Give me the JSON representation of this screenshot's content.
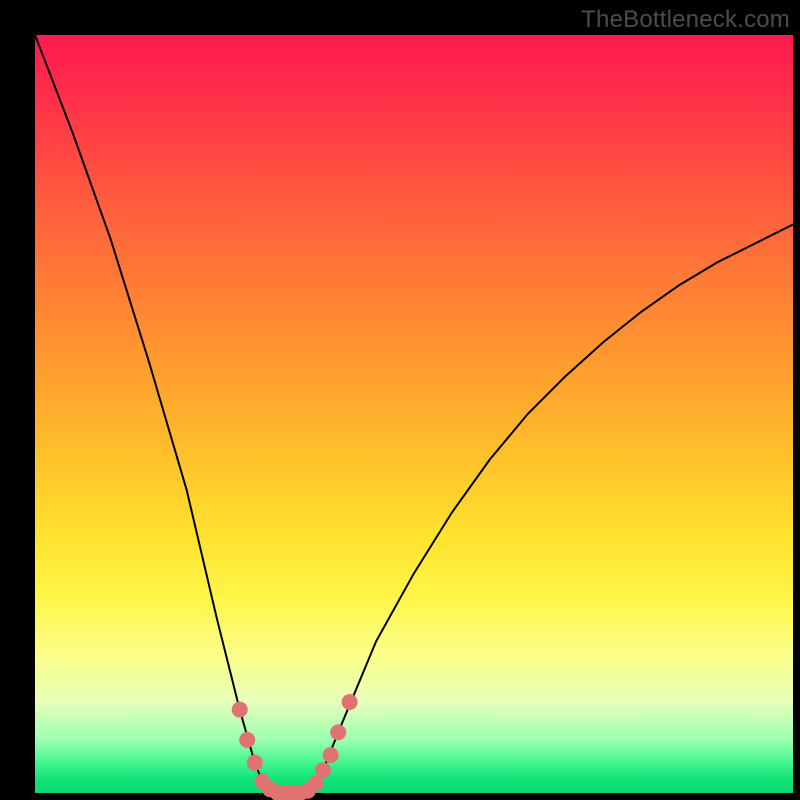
{
  "watermark": "TheBottleneck.com",
  "colors": {
    "frame": "#000000",
    "curve": "#000000",
    "marker": "#e07272",
    "gradient_top": "#ff1a4f",
    "gradient_bottom": "#0bd872"
  },
  "chart_data": {
    "type": "line",
    "title": "",
    "xlabel": "",
    "ylabel": "",
    "xlim": [
      0,
      100
    ],
    "ylim": [
      0,
      100
    ],
    "x": [
      0,
      5,
      10,
      15,
      20,
      24,
      27,
      29,
      30,
      31,
      32,
      33,
      34,
      35,
      36,
      37,
      38,
      40,
      45,
      50,
      55,
      60,
      65,
      70,
      75,
      80,
      85,
      90,
      95,
      100
    ],
    "y": [
      100,
      87,
      73,
      57,
      40,
      23,
      11,
      4,
      1.5,
      0.5,
      0,
      0,
      0,
      0,
      0.3,
      1.2,
      3,
      8,
      20,
      29,
      37,
      44,
      50,
      55,
      59.5,
      63.5,
      67,
      70,
      72.5,
      75
    ],
    "markers": [
      {
        "x": 27,
        "y": 11
      },
      {
        "x": 28,
        "y": 7
      },
      {
        "x": 29,
        "y": 4
      },
      {
        "x": 30,
        "y": 1.5
      },
      {
        "x": 31,
        "y": 0.5
      },
      {
        "x": 32,
        "y": 0
      },
      {
        "x": 33,
        "y": 0
      },
      {
        "x": 34,
        "y": 0
      },
      {
        "x": 35,
        "y": 0
      },
      {
        "x": 36,
        "y": 0.3
      },
      {
        "x": 37,
        "y": 1.2
      },
      {
        "x": 38,
        "y": 3
      },
      {
        "x": 39,
        "y": 5
      },
      {
        "x": 40,
        "y": 8
      },
      {
        "x": 41.5,
        "y": 12
      }
    ]
  }
}
